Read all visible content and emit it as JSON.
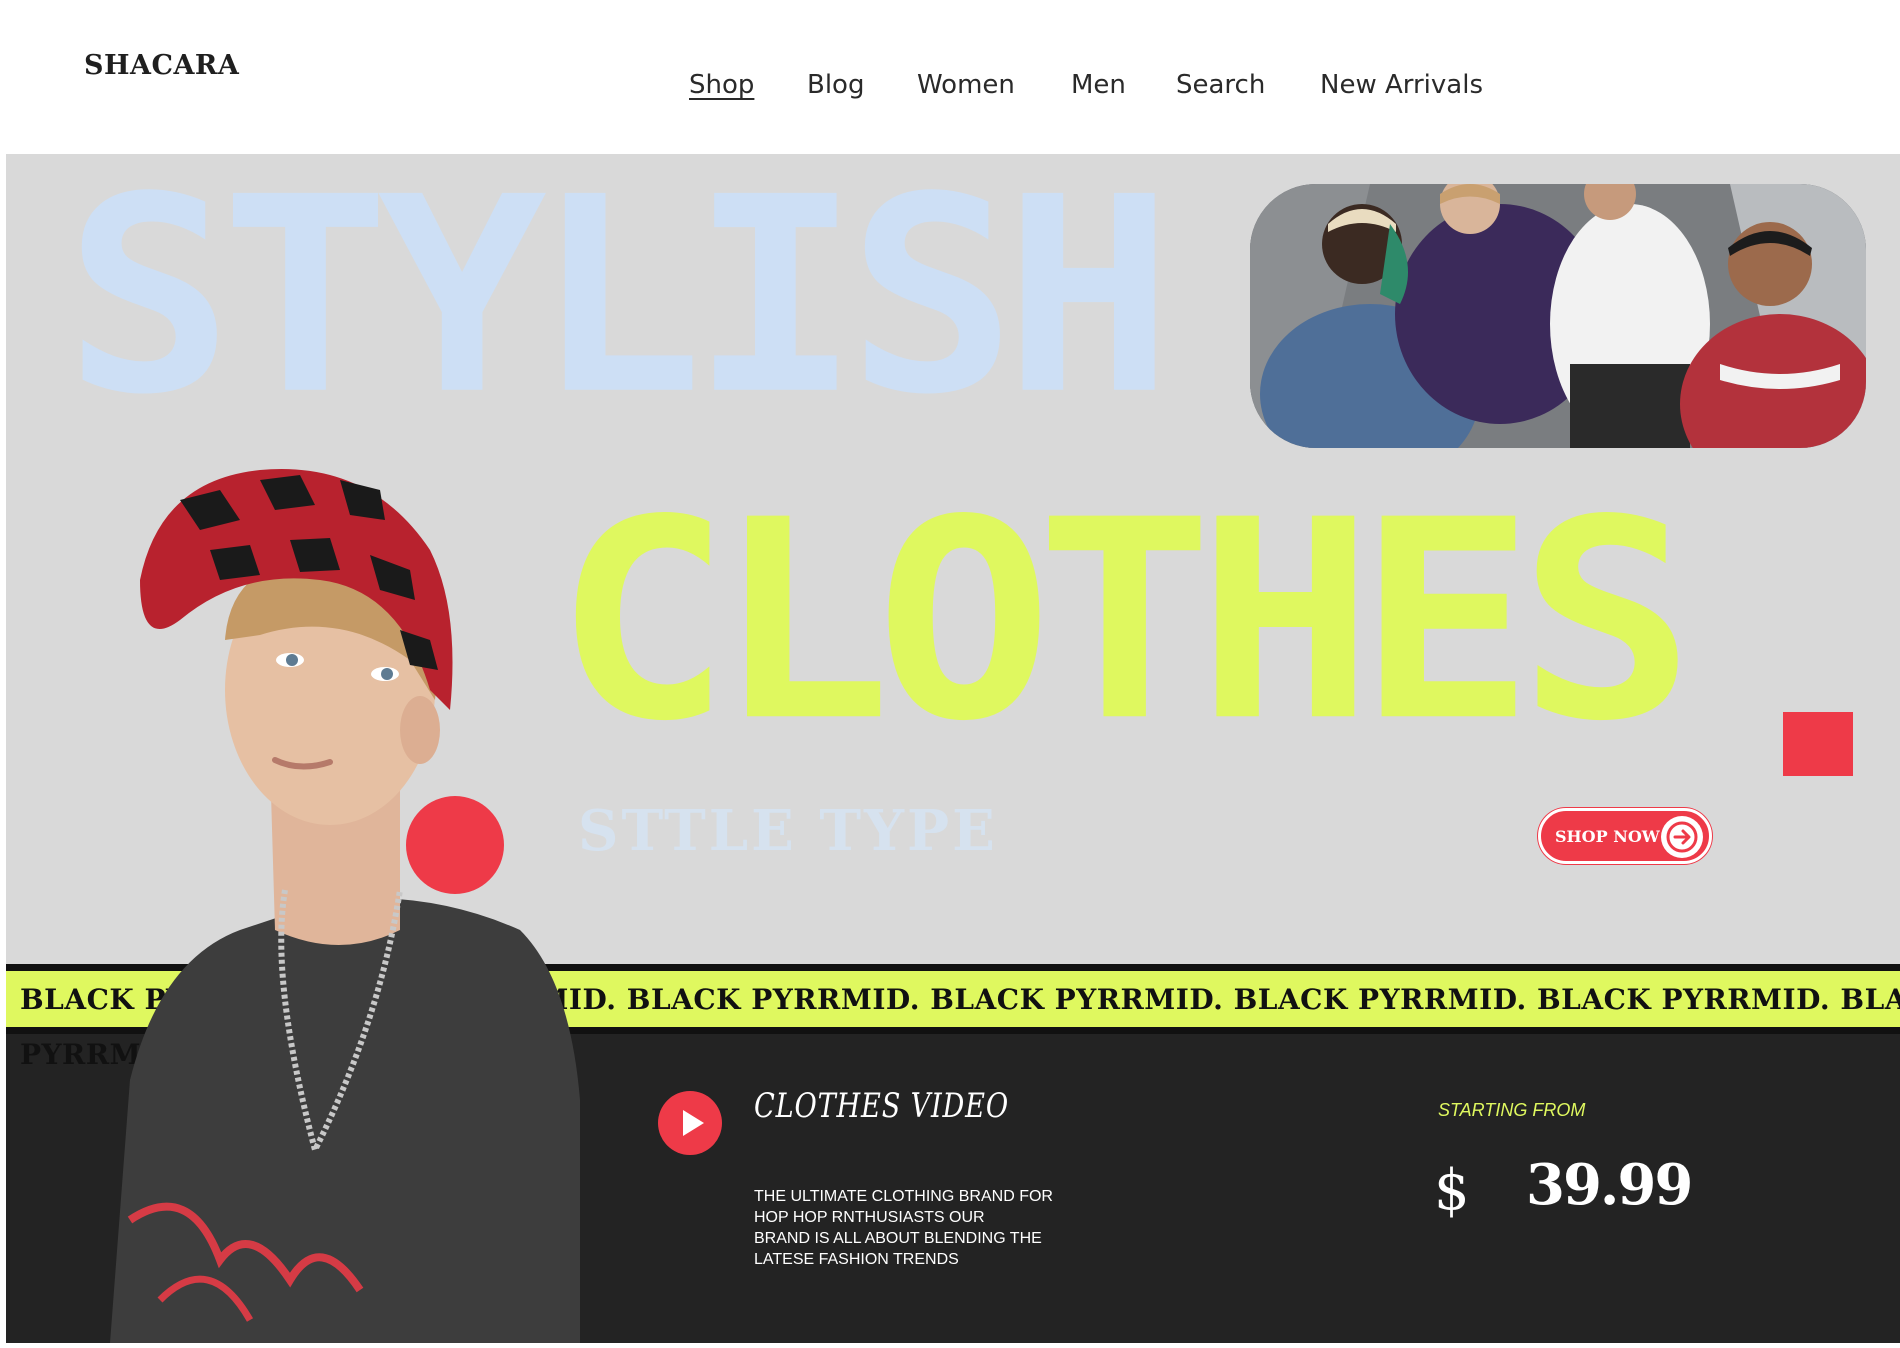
{
  "brand": {
    "logo": "SHACARA"
  },
  "nav": {
    "items": [
      {
        "label": "Shop",
        "active": true
      },
      {
        "label": "Blog",
        "active": false
      },
      {
        "label": "Women",
        "active": false
      },
      {
        "label": "Men",
        "active": false
      },
      {
        "label": "Search",
        "active": false
      },
      {
        "label": "New Arrivals",
        "active": false
      }
    ]
  },
  "hero": {
    "headline_top": "STYLISH",
    "headline_bottom": "CLOTHES",
    "subtitle": "STTLE TYPE",
    "cta_label": "SHOP NOW",
    "cta_icon": "arrow-right-icon"
  },
  "marquee": {
    "text": "BLACK PYRRMID. BLACK PYRRMID. BLACK PYRRMID. BLACK PYRRMID. BLACK PYRRMID. BLACK PYRRMID. BLACK",
    "overflow_text": "PYRRMID"
  },
  "video": {
    "title": "CLOTHES VIDEO",
    "play_icon": "play-icon",
    "description": [
      "THE ULTIMATE CLOTHING BRAND FOR",
      "HOP HOP RNTHUSIASTS OUR",
      "BRAND IS ALL ABOUT BLENDING THE",
      "LATESE FASHION TRENDS"
    ]
  },
  "pricing": {
    "label": "STARTING FROM",
    "currency": "$",
    "amount": "39.99"
  },
  "colors": {
    "accent_red": "#ee3a48",
    "accent_lime": "#dff85f",
    "pale_blue": "#cddff5",
    "hero_bg": "#d9d9d9",
    "dark_bg": "#232323"
  }
}
